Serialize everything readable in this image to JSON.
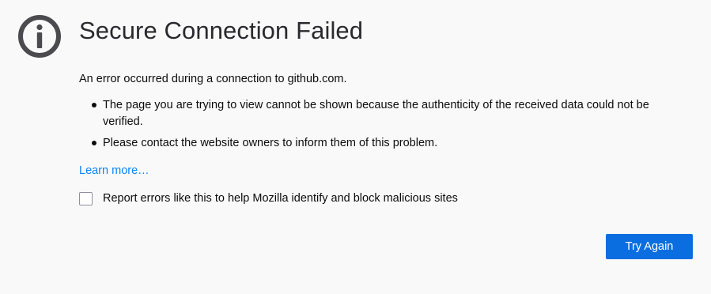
{
  "error": {
    "icon": "info-icon",
    "title": "Secure Connection Failed",
    "description": "An error occurred during a connection to github.com.",
    "reasons": [
      "The page you are trying to view cannot be shown because the authenticity of the received data could not be verified.",
      "Please contact the website owners to inform them of this problem."
    ],
    "learn_more": "Learn more…",
    "report_checkbox_label": "Report errors like this to help Mozilla identify and block malicious sites",
    "report_checked": false,
    "try_again": "Try Again"
  },
  "colors": {
    "background": "#f9f9fa",
    "link": "#0a84ff",
    "button": "#0a6ee0",
    "icon": "#4a4a4f"
  }
}
